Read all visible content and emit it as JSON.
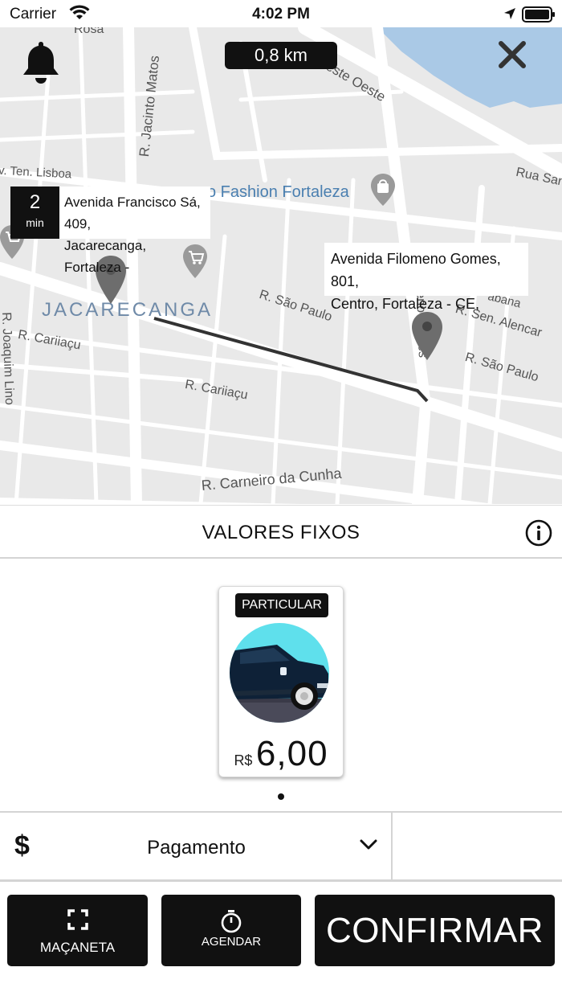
{
  "status_bar": {
    "carrier": "Carrier",
    "time": "4:02 PM"
  },
  "map": {
    "distance": "0,8 km",
    "eta": {
      "value": "2",
      "unit": "min"
    },
    "origin_address": [
      "Avenida Francisco Sá, 409,",
      "Jacarecanga, Fortaleza -"
    ],
    "destination_address": [
      "Avenida Filomeno Gomes, 801,",
      "Centro, Fortaleza - CE,"
    ],
    "labels": {
      "rosa": "Rosa",
      "av_leste_oeste": "Av. Leste Oeste",
      "r_jacinto_matos": "R. Jacinto Matos",
      "av_ten_lisboa": "v. Ten. Lisboa",
      "fashion": "o Fashion Fortaleza",
      "rua_san": "Rua San",
      "jacarecanga": "JACARECANGA",
      "r_sao_paulo_1": "R. São Paulo",
      "r_sao_paulo_2": "R. São Paulo",
      "r_sen_alencar": "R. Sen. Alencar",
      "r_cariiacu_1": "R. Cariiaçu",
      "r_cariiacu_2": "R. Cariiaçu",
      "r_joaquim_lino": "R. Joaquim Lino",
      "r_carneiro": "R. Carneiro da Cunha",
      "filomeno_gomes": "eno Gomes",
      "iabana": "abana"
    }
  },
  "sheet": {
    "title": "VALORES FIXOS",
    "vehicles": [
      {
        "tag": "PARTICULAR",
        "currency": "R$",
        "price": "6,00"
      }
    ]
  },
  "payment": {
    "label": "Pagamento"
  },
  "actions": {
    "macaneta": "MAÇANETA",
    "agendar": "AGENDAR",
    "confirmar": "CONFIRMAR"
  },
  "colors": {
    "primary": "#111111",
    "map_bg": "#e9e9e9",
    "water": "#aac9e6",
    "route": "#333333",
    "vehicle_circle": "#5fe0ec"
  }
}
